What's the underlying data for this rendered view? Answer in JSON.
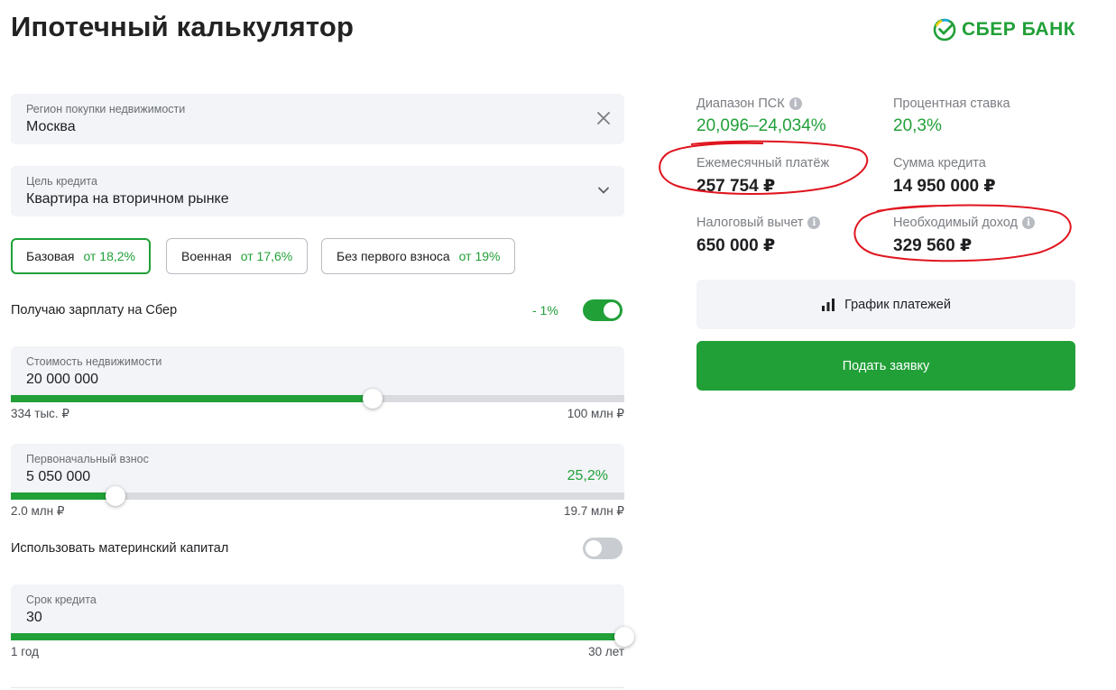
{
  "page": {
    "title": "Ипотечный калькулятор"
  },
  "brand": {
    "name": "СБЕР БАНК",
    "color": "#21a038"
  },
  "region": {
    "label": "Регион покупки недвижимости",
    "value": "Москва",
    "clear_icon": "close-icon"
  },
  "goal": {
    "label": "Цель кредита",
    "value": "Квартира на вторичном рынке",
    "icon": "chevron-down-icon"
  },
  "programs": [
    {
      "name": "Базовая",
      "rate": "от 18,2%",
      "selected": true
    },
    {
      "name": "Военная",
      "rate": "от 17,6%",
      "selected": false
    },
    {
      "name": "Без первого взноса",
      "rate": "от 19%",
      "selected": false
    }
  ],
  "salary": {
    "label": "Получаю зарплату на Сбер",
    "discount": "- 1%",
    "enabled": true
  },
  "property_cost": {
    "label": "Стоимость недвижимости",
    "value": "20 000 000",
    "min_label": "334 тыс. ₽",
    "max_label": "100 млн ₽",
    "level": 0.59
  },
  "down_payment": {
    "label": "Первоначальный взнос",
    "value": "5 050 000",
    "percent": "25,2%",
    "min_label": "2.0 млн ₽",
    "max_label": "19.7 млн ₽",
    "level": 0.17
  },
  "maternity": {
    "label": "Использовать материнский капитал",
    "enabled": false
  },
  "term": {
    "label": "Срок кредита",
    "value": "30",
    "min_label": "1 год",
    "max_label": "30 лет",
    "level": 1.0
  },
  "results": {
    "psk": {
      "label": "Диапазон ПСК",
      "value": "20,096–24,034%"
    },
    "rate": {
      "label": "Процентная ставка",
      "value": "20,3%"
    },
    "monthly": {
      "label": "Ежемесячный платёж",
      "value": "257 754 ₽"
    },
    "loan_sum": {
      "label": "Сумма кредита",
      "value": "14 950 000 ₽"
    },
    "tax": {
      "label": "Налоговый вычет",
      "value": "650 000 ₽"
    },
    "income": {
      "label": "Необходимый доход",
      "value": "329 560 ₽"
    }
  },
  "actions": {
    "schedule_label": "График платежей",
    "schedule_icon": "bar-chart-icon",
    "apply_label": "Подать заявку"
  },
  "annotation_color": "#e0141e"
}
